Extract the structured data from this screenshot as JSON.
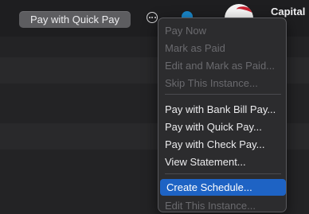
{
  "toolbar": {
    "quick_pay_button": "Pay with Quick Pay",
    "biller_name": "Capital"
  },
  "icons": {
    "more": "more-options-icon",
    "status": "status-dot-icon",
    "biller_logo": "biller-logo-icon"
  },
  "colors": {
    "selection": "#1e63c4",
    "status_dot": "#1a86c8",
    "logo_red": "#c8202f"
  },
  "context_menu": {
    "group1": [
      {
        "label": "Pay Now",
        "enabled": false
      },
      {
        "label": "Mark as Paid",
        "enabled": false
      },
      {
        "label": "Edit and Mark as Paid...",
        "enabled": false
      },
      {
        "label": "Skip This Instance...",
        "enabled": false
      }
    ],
    "group2": [
      {
        "label": "Pay with Bank Bill Pay...",
        "enabled": true
      },
      {
        "label": "Pay with Quick Pay...",
        "enabled": true
      },
      {
        "label": "Pay with Check Pay...",
        "enabled": true
      },
      {
        "label": "View Statement...",
        "enabled": true
      }
    ],
    "group3": [
      {
        "label": "Create Schedule...",
        "enabled": true,
        "selected": true
      },
      {
        "label": "Edit This Instance...",
        "enabled": false
      }
    ]
  }
}
